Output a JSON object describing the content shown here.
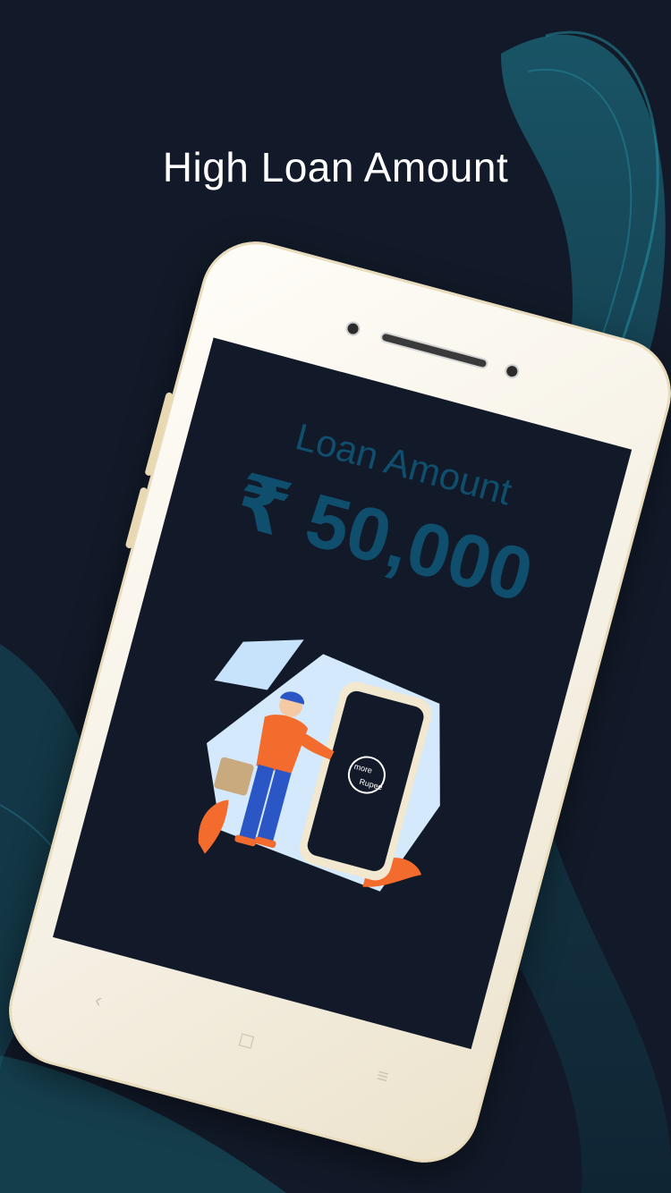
{
  "promo": {
    "headline": "High Loan Amount"
  },
  "device_screen": {
    "label": "Loan Amount",
    "currency_symbol": "₹",
    "amount": "50,000",
    "brand_logo_text_1": "more",
    "brand_logo_text_2": "Rupee"
  },
  "nav_keys": {
    "back": "‹",
    "home": "◻",
    "menu": "≡"
  },
  "colors": {
    "background": "#121a29",
    "accent_teal": "#0f4e6c",
    "wave_teal": "#1f8fa3",
    "device_body": "#f4efe2",
    "orange": "#f36b2d"
  }
}
